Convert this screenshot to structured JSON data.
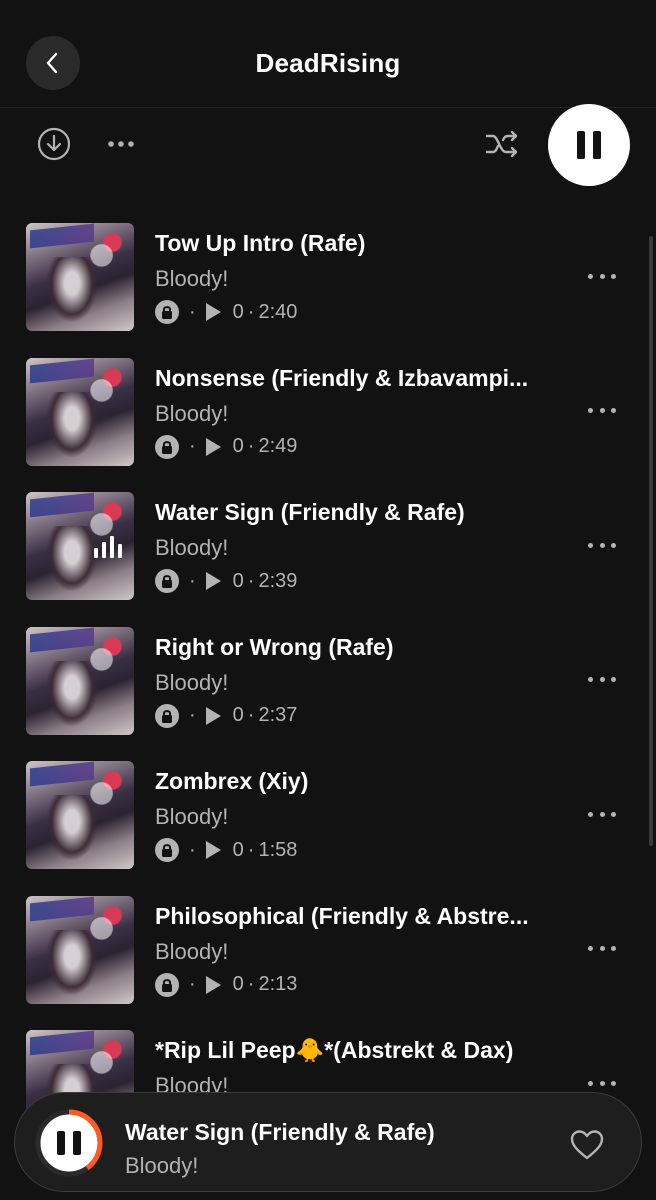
{
  "header": {
    "title": "DeadRising",
    "back_icon": "chevron-left-icon"
  },
  "toolbar": {
    "download_icon": "download-icon",
    "more_icon": "more-horizontal-icon",
    "shuffle_icon": "shuffle-icon",
    "play_pause_icon": "pause-icon"
  },
  "tracks": [
    {
      "title": "Tow Up Intro (Rafe)",
      "artist": "Bloody!",
      "plays": "0",
      "duration": "2:40",
      "playing": false
    },
    {
      "title": "Nonsense (Friendly & Izbavampi...",
      "artist": "Bloody!",
      "plays": "0",
      "duration": "2:49",
      "playing": false
    },
    {
      "title": "Water Sign (Friendly & Rafe)",
      "artist": "Bloody!",
      "plays": "0",
      "duration": "2:39",
      "playing": true
    },
    {
      "title": "Right or Wrong (Rafe)",
      "artist": "Bloody!",
      "plays": "0",
      "duration": "2:37",
      "playing": false
    },
    {
      "title": "Zombrex (Xiy)",
      "artist": "Bloody!",
      "plays": "0",
      "duration": "1:58",
      "playing": false
    },
    {
      "title": "Philosophical (Friendly & Abstre...",
      "artist": "Bloody!",
      "plays": "0",
      "duration": "2:13",
      "playing": false
    },
    {
      "title": "*Rip Lil Peep🐥*(Abstrekt & Dax)",
      "artist": "Bloody!",
      "plays": "",
      "duration": "",
      "playing": false
    }
  ],
  "separator": "·",
  "now_playing": {
    "title": "Water Sign (Friendly & Rafe)",
    "artist": "Bloody!",
    "progress": 0.4,
    "accent_color": "#ff5a1f",
    "like_icon": "heart-outline-icon"
  }
}
